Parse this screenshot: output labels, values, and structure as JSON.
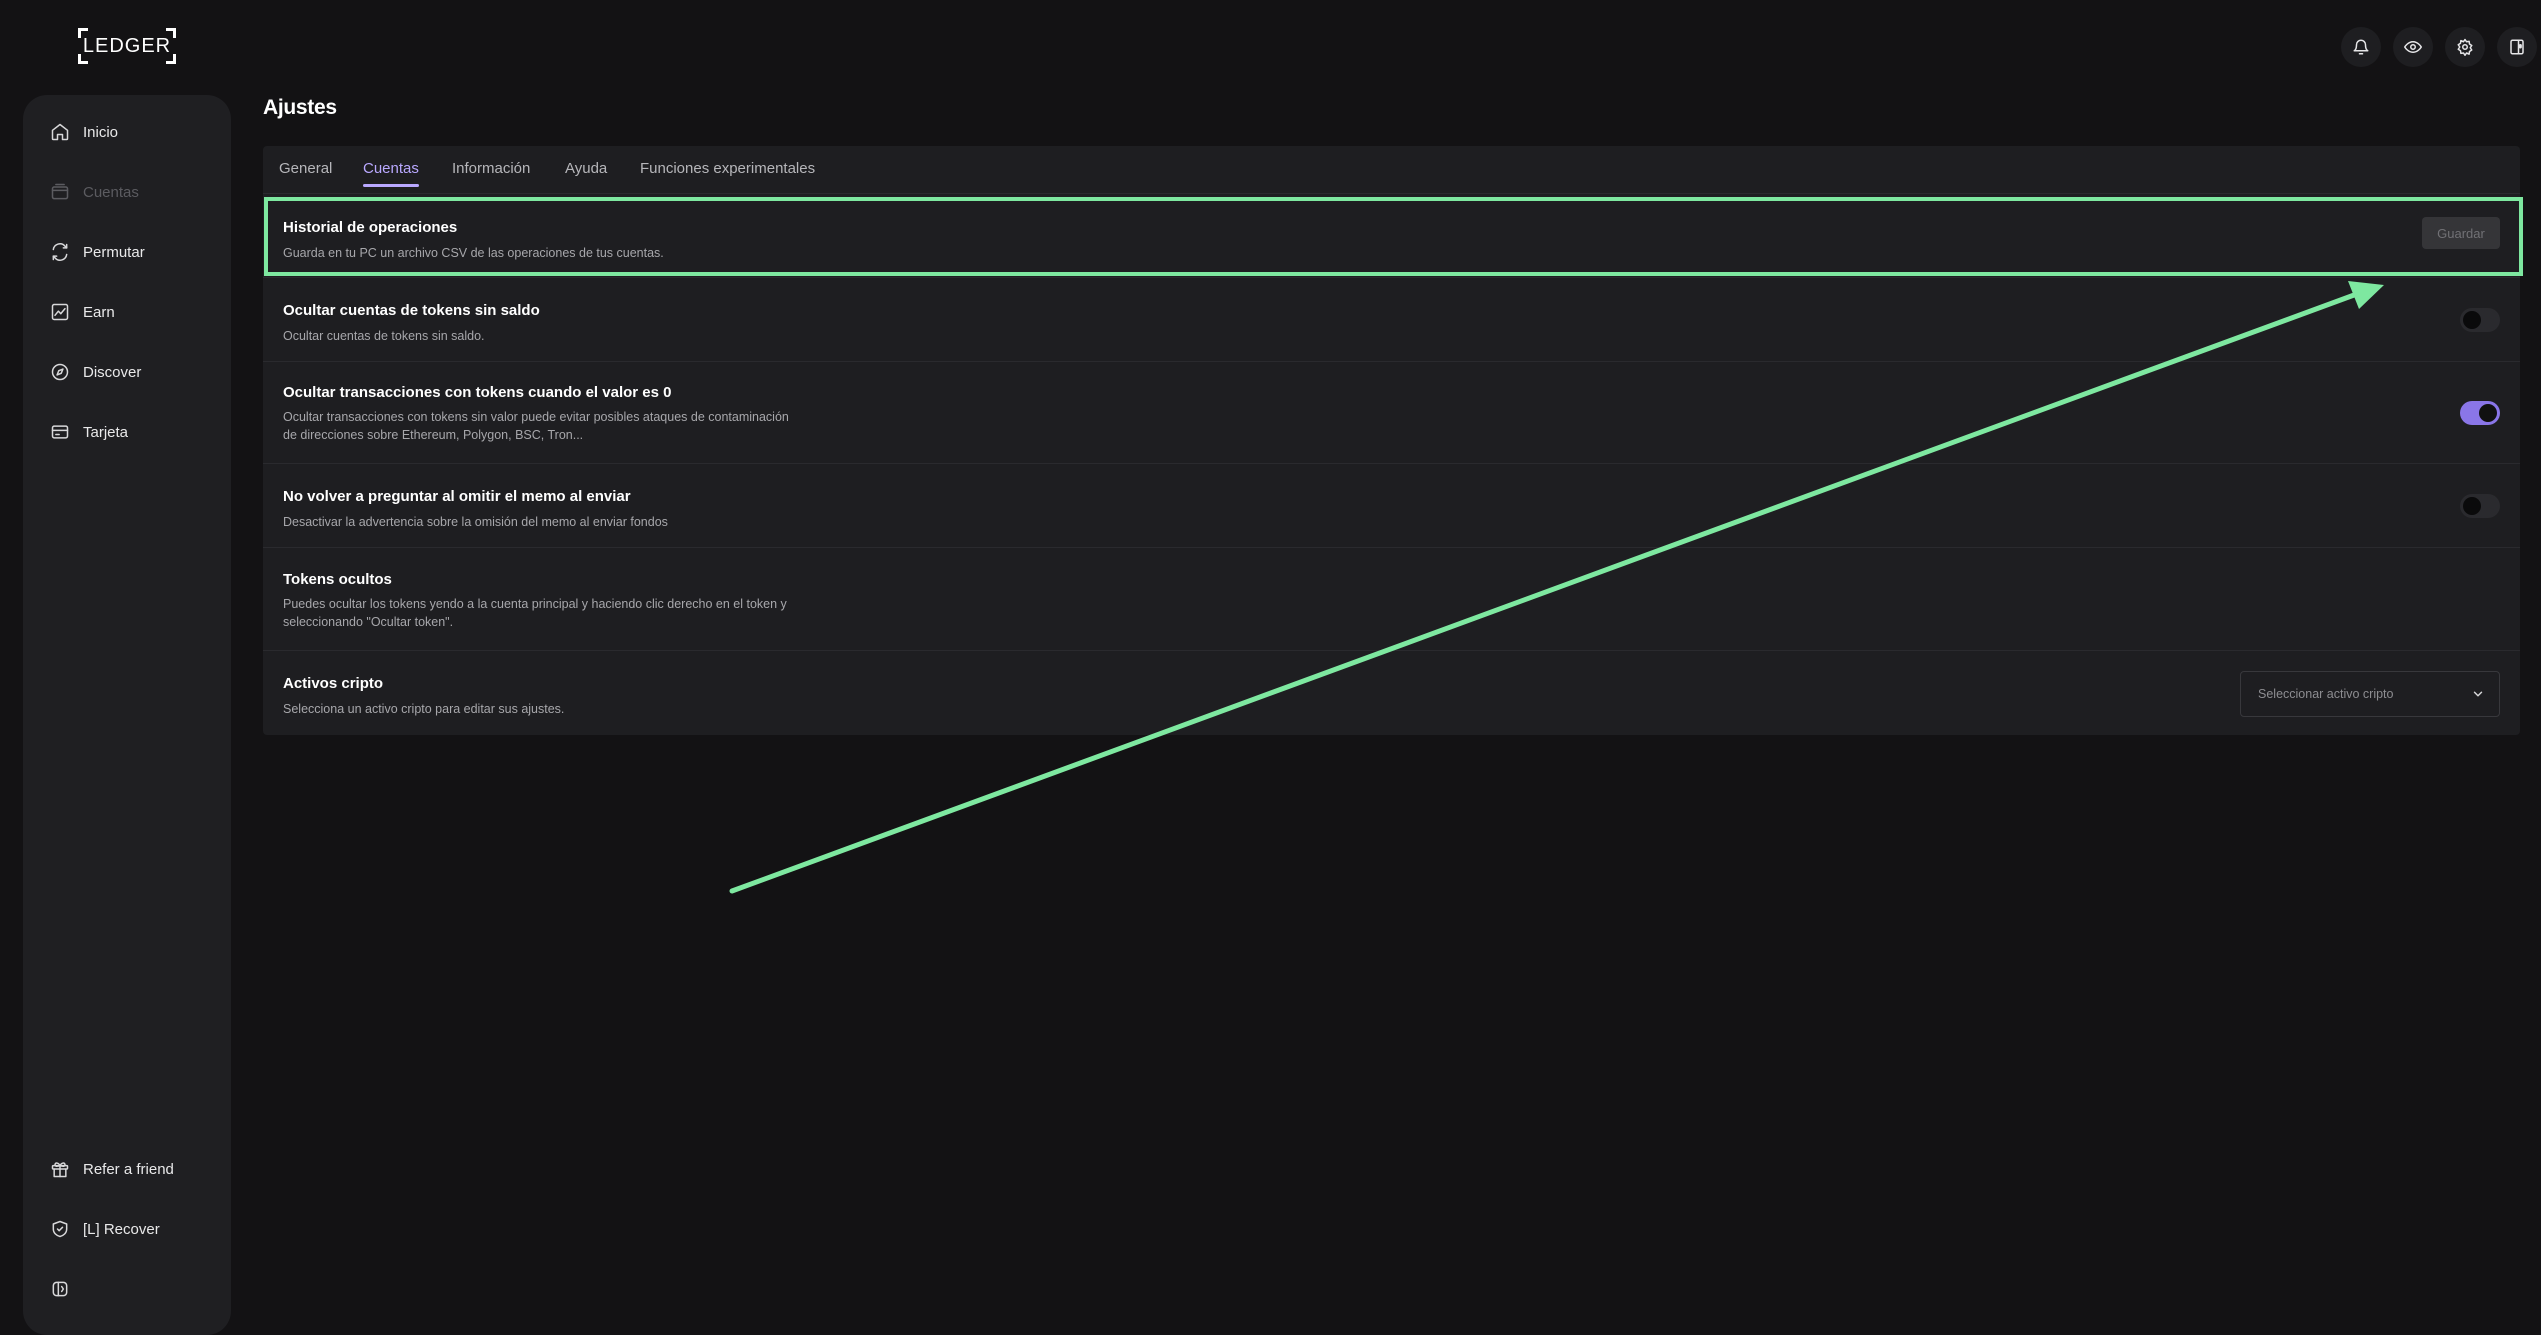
{
  "app": {
    "logo_text": "LEDGER"
  },
  "header_icons": [
    "bell-icon",
    "eye-icon",
    "gear-icon",
    "device-icon"
  ],
  "sidebar": {
    "items": [
      {
        "label": "Inicio",
        "icon": "home-icon",
        "enabled": true
      },
      {
        "label": "Cuentas",
        "icon": "wallet-icon",
        "enabled": false
      },
      {
        "label": "Permutar",
        "icon": "swap-icon",
        "enabled": true
      },
      {
        "label": "Earn",
        "icon": "chart-icon",
        "enabled": true
      },
      {
        "label": "Discover",
        "icon": "compass-icon",
        "enabled": true
      },
      {
        "label": "Tarjeta",
        "icon": "card-icon",
        "enabled": true
      }
    ],
    "bottom_items": [
      {
        "label": "Refer a friend",
        "icon": "gift-icon"
      },
      {
        "label": "[L] Recover",
        "icon": "shield-icon"
      }
    ]
  },
  "page": {
    "title": "Ajustes",
    "tabs": [
      {
        "label": "General",
        "active": false
      },
      {
        "label": "Cuentas",
        "active": true
      },
      {
        "label": "Información",
        "active": false
      },
      {
        "label": "Ayuda",
        "active": false
      },
      {
        "label": "Funciones experimentales",
        "active": false
      }
    ]
  },
  "settings": {
    "history": {
      "title": "Historial de operaciones",
      "desc": "Guarda en tu PC un archivo CSV de las operaciones de tus cuentas.",
      "button": "Guardar"
    },
    "hide_empty": {
      "title": "Ocultar cuentas de tokens sin saldo",
      "desc": "Ocultar cuentas de tokens sin saldo.",
      "enabled": false
    },
    "hide_zero_tx": {
      "title": "Ocultar transacciones con tokens cuando el valor es 0",
      "desc_line1": "Ocultar transacciones con tokens sin valor puede evitar posibles ataques de contaminación",
      "desc_line2": "de direcciones sobre Ethereum, Polygon, BSC, Tron...",
      "enabled": true
    },
    "memo": {
      "title": "No volver a preguntar al omitir el memo al enviar",
      "desc": "Desactivar la advertencia sobre la omisión del memo al enviar fondos",
      "enabled": false
    },
    "hidden_tokens": {
      "title": "Tokens ocultos",
      "desc_line1": "Puedes ocultar los tokens yendo a la cuenta principal y haciendo clic derecho en el token y",
      "desc_line2": "seleccionando \"Ocultar token\"."
    },
    "crypto_assets": {
      "title": "Activos cripto",
      "desc": "Selecciona un activo cripto para editar sus ajustes.",
      "select_placeholder": "Seleccionar activo cripto"
    }
  },
  "colors": {
    "background": "#131214",
    "panel": "#1e1e21",
    "accent": "#b9a8ff",
    "toggle_on": "#8a76e8",
    "highlight": "#7ee8a0"
  }
}
